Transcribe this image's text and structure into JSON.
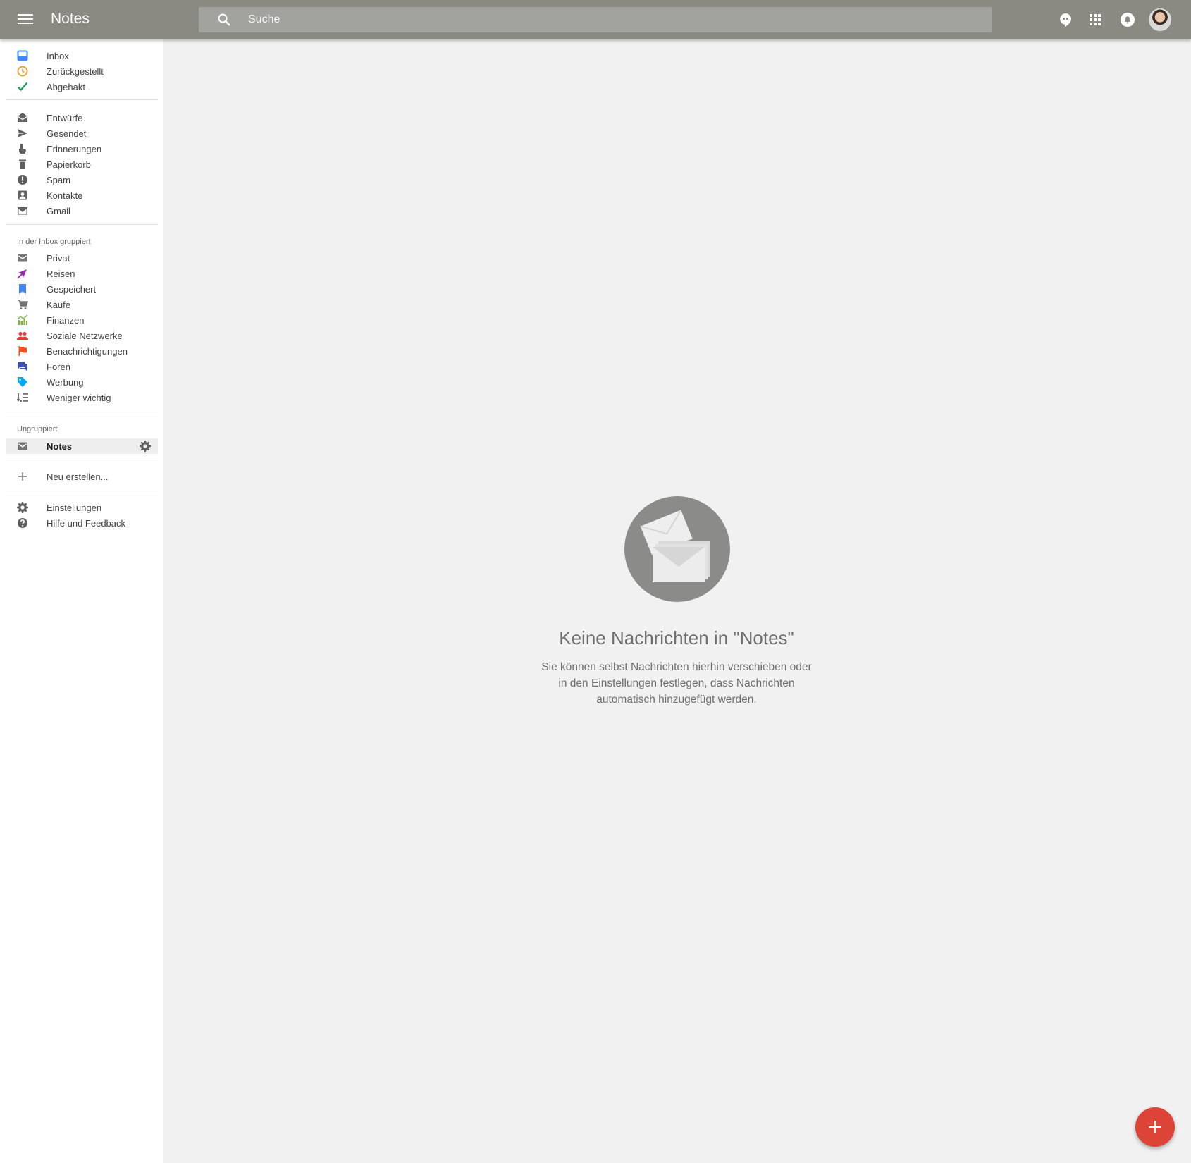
{
  "header": {
    "title": "Notes",
    "search_placeholder": "Suche"
  },
  "sidebar": {
    "primary": [
      {
        "label": "Inbox",
        "icon": "inbox-icon",
        "color": "#4285f4"
      },
      {
        "label": "Zurückgestellt",
        "icon": "clock-icon",
        "color": "#ef9a1f"
      },
      {
        "label": "Abgehakt",
        "icon": "check-icon",
        "color": "#0f9d58"
      }
    ],
    "folders": [
      {
        "label": "Entwürfe",
        "icon": "drafts-icon"
      },
      {
        "label": "Gesendet",
        "icon": "send-icon"
      },
      {
        "label": "Erinnerungen",
        "icon": "reminder-icon"
      },
      {
        "label": "Papierkorb",
        "icon": "trash-icon"
      },
      {
        "label": "Spam",
        "icon": "spam-icon"
      },
      {
        "label": "Kontakte",
        "icon": "contacts-icon"
      },
      {
        "label": "Gmail",
        "icon": "gmail-icon"
      }
    ],
    "grouped_title": "In der Inbox gruppiert",
    "grouped": [
      {
        "label": "Privat",
        "icon": "mail-icon",
        "color": "#757575"
      },
      {
        "label": "Reisen",
        "icon": "plane-icon",
        "color": "#9c27b0"
      },
      {
        "label": "Gespeichert",
        "icon": "bookmark-icon",
        "color": "#4285f4"
      },
      {
        "label": "Käufe",
        "icon": "cart-icon",
        "color": "#757575"
      },
      {
        "label": "Finanzen",
        "icon": "chart-icon",
        "color": "#7cb342"
      },
      {
        "label": "Soziale Netzwerke",
        "icon": "people-icon",
        "color": "#e53935"
      },
      {
        "label": "Benachrichtigungen",
        "icon": "flag-icon",
        "color": "#f4511e"
      },
      {
        "label": "Foren",
        "icon": "forum-icon",
        "color": "#3f51b5"
      },
      {
        "label": "Werbung",
        "icon": "tag-icon",
        "color": "#03a9f4"
      },
      {
        "label": "Weniger wichtig",
        "icon": "low-priority-icon",
        "color": "#757575"
      }
    ],
    "ungrouped_title": "Ungruppiert",
    "ungrouped": [
      {
        "label": "Notes",
        "icon": "mail-icon"
      }
    ],
    "create_label": "Neu erstellen...",
    "settings_label": "Einstellungen",
    "help_label": "Hilfe und Feedback"
  },
  "empty_state": {
    "title": "Keine Nachrichten in \"Notes\"",
    "line1": "Sie können selbst Nachrichten hierhin verschieben oder",
    "line2": "in den Einstellungen festlegen, dass Nachrichten",
    "line3": "automatisch hinzugefügt werden."
  },
  "colors": {
    "header_bg": "#8a8a83",
    "fab": "#db4437"
  }
}
